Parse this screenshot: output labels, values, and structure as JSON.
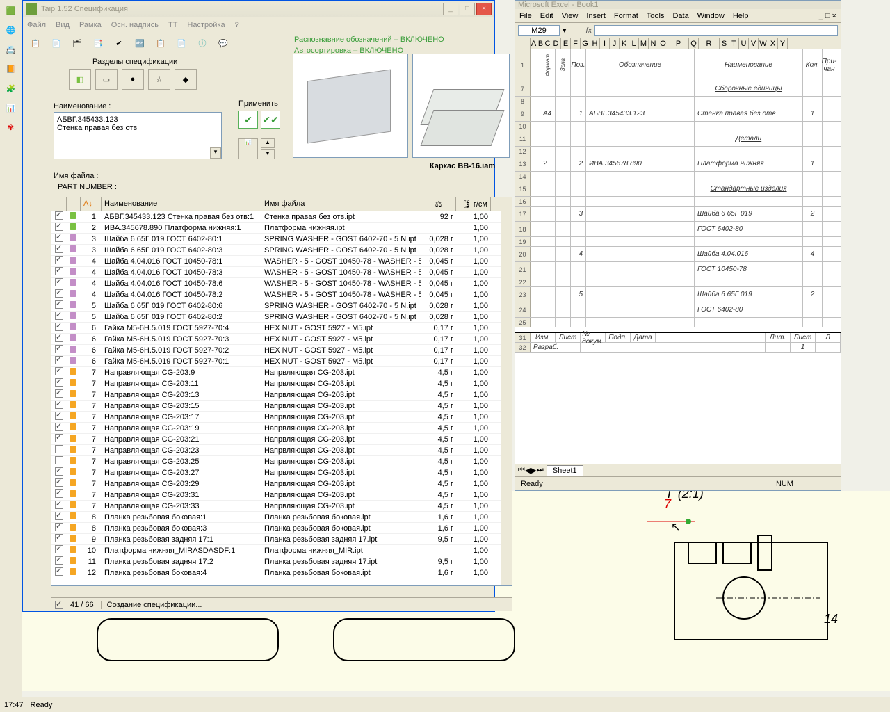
{
  "taip": {
    "title": "Taip 1.52 Спецификация",
    "menu": [
      "Файл",
      "Вид",
      "Рамка",
      "Осн. надпись",
      "ТТ",
      "Настройка",
      "?"
    ],
    "status_lines": [
      "Распознавние обозначений – ВКЛЮЧЕНО",
      "Автосортировка – ВКЛЮЧЕНО"
    ],
    "sections_label": "Разделы спецификации",
    "name_label": "Наименование :",
    "name_value": "АБВГ.345433.123\nСтенка правая без отв",
    "apply_label": "Применить",
    "preview_caption": "Каркас BB-16.iam",
    "file_label": "Имя файла :",
    "part_label": "PART NUMBER :",
    "grid_headers": {
      "name": "Наименование",
      "file": "Имя файла",
      "den": "г/см"
    },
    "rows": [
      {
        "chk": true,
        "dot": "d-grn",
        "n": 1,
        "name": "АБВГ.345433.123 Стенка правая без отв:1",
        "file": "Стенка правая без отв.ipt",
        "wt": "92 г",
        "den": "1,00"
      },
      {
        "chk": true,
        "dot": "d-grn",
        "n": 2,
        "name": "ИВА.345678.890 Платформа нижняя:1",
        "file": "Платформа нижняя.ipt",
        "wt": "",
        "den": "1,00"
      },
      {
        "chk": true,
        "dot": "d-pur",
        "n": 3,
        "name": "Шайба 6 65Г 019 ГОСТ 6402-80:1",
        "file": "SPRING WASHER - GOST 6402-70 - 5 N.ipt",
        "wt": "0,028 г",
        "den": "1,00"
      },
      {
        "chk": true,
        "dot": "d-pur",
        "n": 3,
        "name": "Шайба 6 65Г 019 ГОСТ 6402-80:3",
        "file": "SPRING WASHER - GOST 6402-70 - 5 N.ipt",
        "wt": "0,028 г",
        "den": "1,00"
      },
      {
        "chk": true,
        "dot": "d-pur",
        "n": 4,
        "name": "Шайба 4.04.016 ГОСТ 10450-78:1",
        "file": "WASHER - 5 - GOST 10450-78 - WASHER - 5...",
        "wt": "0,045 г",
        "den": "1,00"
      },
      {
        "chk": true,
        "dot": "d-pur",
        "n": 4,
        "name": "Шайба 4.04.016 ГОСТ 10450-78:3",
        "file": "WASHER - 5 - GOST 10450-78 - WASHER - 5...",
        "wt": "0,045 г",
        "den": "1,00"
      },
      {
        "chk": true,
        "dot": "d-pur",
        "n": 4,
        "name": "Шайба 4.04.016 ГОСТ 10450-78:6",
        "file": "WASHER - 5 - GOST 10450-78 - WASHER - 5...",
        "wt": "0,045 г",
        "den": "1,00"
      },
      {
        "chk": true,
        "dot": "d-pur",
        "n": 4,
        "name": "Шайба 4.04.016 ГОСТ 10450-78:2",
        "file": "WASHER - 5 - GOST 10450-78 - WASHER - 5...",
        "wt": "0,045 г",
        "den": "1,00"
      },
      {
        "chk": true,
        "dot": "d-pur",
        "n": 5,
        "name": "Шайба 6 65Г 019 ГОСТ 6402-80:6",
        "file": "SPRING WASHER - GOST 6402-70 - 5 N.ipt",
        "wt": "0,028 г",
        "den": "1,00"
      },
      {
        "chk": true,
        "dot": "d-pur",
        "n": 5,
        "name": "Шайба 6 65Г 019 ГОСТ 6402-80:2",
        "file": "SPRING WASHER - GOST 6402-70 - 5 N.ipt",
        "wt": "0,028 г",
        "den": "1,00"
      },
      {
        "chk": true,
        "dot": "d-pur",
        "n": 6,
        "name": "Гайка M5-6H.5.019 ГОСТ 5927-70:4",
        "file": "HEX NUT - GOST 5927 - M5.ipt",
        "wt": "0,17 г",
        "den": "1,00"
      },
      {
        "chk": true,
        "dot": "d-pur",
        "n": 6,
        "name": "Гайка M5-6H.5.019 ГОСТ 5927-70:3",
        "file": "HEX NUT - GOST 5927 - M5.ipt",
        "wt": "0,17 г",
        "den": "1,00"
      },
      {
        "chk": true,
        "dot": "d-pur",
        "n": 6,
        "name": "Гайка M5-6H.5.019 ГОСТ 5927-70:2",
        "file": "HEX NUT - GOST 5927 - M5.ipt",
        "wt": "0,17 г",
        "den": "1,00"
      },
      {
        "chk": true,
        "dot": "d-pur",
        "n": 6,
        "name": "Гайка M5-6H.5.019 ГОСТ 5927-70:1",
        "file": "HEX NUT - GOST 5927 - M5.ipt",
        "wt": "0,17 г",
        "den": "1,00"
      },
      {
        "chk": true,
        "dot": "d-org",
        "n": 7,
        "name": "Направляющая CG-203:9",
        "file": "Напрвляющая CG-203.ipt",
        "wt": "4,5 г",
        "den": "1,00"
      },
      {
        "chk": true,
        "dot": "d-org",
        "n": 7,
        "name": "Направляющая CG-203:11",
        "file": "Напрвляющая CG-203.ipt",
        "wt": "4,5 г",
        "den": "1,00"
      },
      {
        "chk": true,
        "dot": "d-org",
        "n": 7,
        "name": "Направляющая CG-203:13",
        "file": "Напрвляющая CG-203.ipt",
        "wt": "4,5 г",
        "den": "1,00"
      },
      {
        "chk": true,
        "dot": "d-org",
        "n": 7,
        "name": "Направляющая CG-203:15",
        "file": "Напрвляющая CG-203.ipt",
        "wt": "4,5 г",
        "den": "1,00"
      },
      {
        "chk": true,
        "dot": "d-org",
        "n": 7,
        "name": "Направляющая CG-203:17",
        "file": "Напрвляющая CG-203.ipt",
        "wt": "4,5 г",
        "den": "1,00"
      },
      {
        "chk": true,
        "dot": "d-org",
        "n": 7,
        "name": "Направляющая CG-203:19",
        "file": "Напрвляющая CG-203.ipt",
        "wt": "4,5 г",
        "den": "1,00"
      },
      {
        "chk": true,
        "dot": "d-org",
        "n": 7,
        "name": "Направляющая CG-203:21",
        "file": "Напрвляющая CG-203.ipt",
        "wt": "4,5 г",
        "den": "1,00"
      },
      {
        "chk": false,
        "dot": "d-org",
        "n": 7,
        "name": "Направляющая CG-203:23",
        "file": "Напрвляющая CG-203.ipt",
        "wt": "4,5 г",
        "den": "1,00"
      },
      {
        "chk": false,
        "dot": "d-org",
        "n": 7,
        "name": "Направляющая CG-203:25",
        "file": "Напрвляющая CG-203.ipt",
        "wt": "4,5 г",
        "den": "1,00"
      },
      {
        "chk": true,
        "dot": "d-org",
        "n": 7,
        "name": "Направляющая CG-203:27",
        "file": "Напрвляющая CG-203.ipt",
        "wt": "4,5 г",
        "den": "1,00"
      },
      {
        "chk": true,
        "dot": "d-org",
        "n": 7,
        "name": "Направляющая CG-203:29",
        "file": "Напрвляющая CG-203.ipt",
        "wt": "4,5 г",
        "den": "1,00"
      },
      {
        "chk": true,
        "dot": "d-org",
        "n": 7,
        "name": "Направляющая CG-203:31",
        "file": "Напрвляющая CG-203.ipt",
        "wt": "4,5 г",
        "den": "1,00"
      },
      {
        "chk": true,
        "dot": "d-org",
        "n": 7,
        "name": "Направляющая CG-203:33",
        "file": "Напрвляющая CG-203.ipt",
        "wt": "4,5 г",
        "den": "1,00"
      },
      {
        "chk": true,
        "dot": "d-org",
        "n": 8,
        "name": "Планка резьбовая боковая:1",
        "file": "Планка резьбовая боковая.ipt",
        "wt": "1,6 г",
        "den": "1,00"
      },
      {
        "chk": true,
        "dot": "d-org",
        "n": 8,
        "name": "Планка резьбовая боковая:3",
        "file": "Планка резьбовая боковая.ipt",
        "wt": "1,6 г",
        "den": "1,00"
      },
      {
        "chk": true,
        "dot": "d-org",
        "n": 9,
        "name": "Планка резьбовая задняя 17:1",
        "file": "Планка резьбовая задняя 17.ipt",
        "wt": "9,5 г",
        "den": "1,00"
      },
      {
        "chk": true,
        "dot": "d-org",
        "n": 10,
        "name": "Платформа нижняя_MIRASDASDF:1",
        "file": "Платформа нижняя_MIR.ipt",
        "wt": "",
        "den": "1,00"
      },
      {
        "chk": true,
        "dot": "d-org",
        "n": 11,
        "name": "Планка резьбовая задняя 17:2",
        "file": "Планка резьбовая задняя 17.ipt",
        "wt": "9,5 г",
        "den": "1,00"
      },
      {
        "chk": true,
        "dot": "d-org",
        "n": 12,
        "name": "Планка резьбовая боковая:4",
        "file": "Планка резьбовая боковая.ipt",
        "wt": "1,6 г",
        "den": "1,00"
      }
    ],
    "counter": "41 / 66",
    "status": "Создание спецификации..."
  },
  "excel": {
    "title": "Microsoft Excel - Book1",
    "menu": [
      "File",
      "Edit",
      "View",
      "Insert",
      "Format",
      "Tools",
      "Data",
      "Window",
      "Help"
    ],
    "cell_ref": "M29",
    "cols": [
      "A",
      "B",
      "C",
      "D",
      "E",
      "F",
      "G",
      "H",
      "I",
      "J",
      "K",
      "L",
      "M",
      "N",
      "O",
      "P",
      "Q",
      "R",
      "S",
      "T",
      "U",
      "V",
      "W",
      "X",
      "Y"
    ],
    "hdr": {
      "fmt": "Формат",
      "zone": "Зона",
      "poz": "Поз.",
      "des": "Обозначение",
      "name": "Наименование",
      "kol": "Кол.",
      "note": "При-\nчан"
    },
    "rows": [
      {
        "rn": "1",
        "type": "hdr"
      },
      {
        "rn": "7",
        "type": "section",
        "name": "Сборочные единицы"
      },
      {
        "rn": "8",
        "type": "blank"
      },
      {
        "rn": "9",
        "fmt": "А4",
        "poz": "1",
        "des": "АБВГ.345433.123",
        "name": "Стенка правая без отв",
        "kol": "1"
      },
      {
        "rn": "10",
        "type": "blank"
      },
      {
        "rn": "11",
        "type": "section",
        "name": "Детали"
      },
      {
        "rn": "12",
        "type": "blank"
      },
      {
        "rn": "13",
        "fmt": "?",
        "poz": "2",
        "des": "ИВА.345678.890",
        "name": "Платформа нижняя",
        "kol": "1"
      },
      {
        "rn": "14",
        "type": "blank"
      },
      {
        "rn": "15",
        "type": "section",
        "name": "Стандартные изделия"
      },
      {
        "rn": "16",
        "type": "blank"
      },
      {
        "rn": "17",
        "poz": "3",
        "name": "Шайба 6 65Г 019",
        "kol": "2"
      },
      {
        "rn": "18",
        "name": "ГОСТ 6402-80"
      },
      {
        "rn": "19",
        "type": "blank"
      },
      {
        "rn": "20",
        "poz": "4",
        "name": "Шайба 4.04.016",
        "kol": "4"
      },
      {
        "rn": "21",
        "name": "ГОСТ 10450-78"
      },
      {
        "rn": "22",
        "type": "blank"
      },
      {
        "rn": "23",
        "poz": "5",
        "name": "Шайба 6 65Г 019",
        "kol": "2"
      },
      {
        "rn": "24",
        "name": "ГОСТ 6402-80"
      },
      {
        "rn": "25",
        "type": "blank"
      }
    ],
    "stamp_hdr": [
      "Изм.",
      "Лист",
      "№ докум.",
      "Подп.",
      "Дата"
    ],
    "stamp_row": "Разраб.",
    "stamp_cols": [
      "Лит.",
      "Лист",
      "Л"
    ],
    "stamp_val": "1",
    "sheet_tab": "Sheet1",
    "ready": "Ready",
    "num": "NUM"
  },
  "bottom": {
    "time": "17:47",
    "ready": "Ready"
  },
  "cad": {
    "label_top": "Г (2:1)",
    "callout7": "7",
    "callout14": "14"
  }
}
